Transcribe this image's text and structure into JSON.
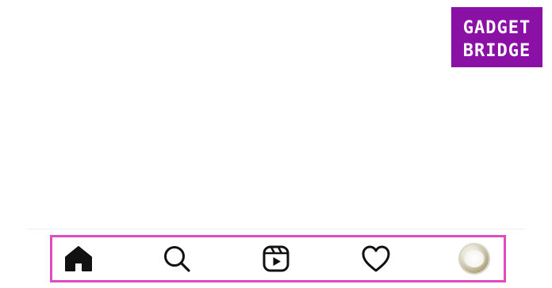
{
  "watermark": {
    "line1": "GADGET",
    "line2": "BRIDGE",
    "background_color": "#8a10a6",
    "text_color": "#ffffff"
  },
  "tab_bar": {
    "highlight_color": "#e04bbf",
    "active_tab": "home",
    "tabs": [
      {
        "name": "home",
        "icon": "home-filled-icon"
      },
      {
        "name": "search",
        "icon": "search-icon"
      },
      {
        "name": "reels",
        "icon": "reels-icon"
      },
      {
        "name": "activity",
        "icon": "heart-icon"
      },
      {
        "name": "profile",
        "icon": "profile-avatar"
      }
    ]
  }
}
